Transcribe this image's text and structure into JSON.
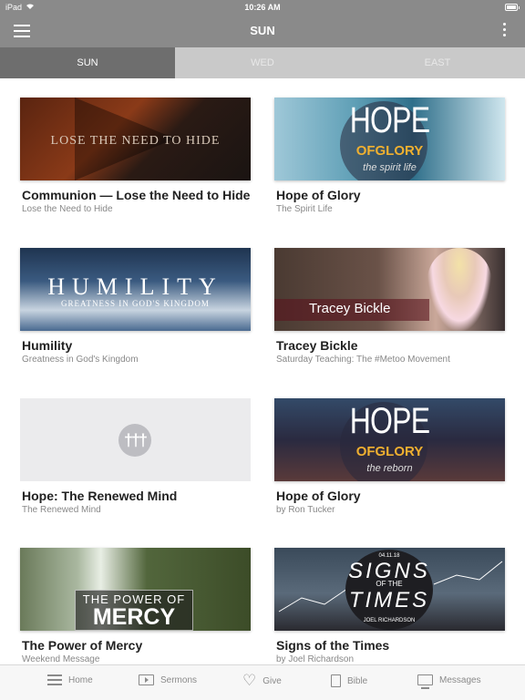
{
  "status_bar": {
    "device": "iPad",
    "time": "10:26 AM"
  },
  "nav": {
    "title": "SUN"
  },
  "tabs": [
    {
      "label": "SUN",
      "active": true
    },
    {
      "label": "WED",
      "active": false
    },
    {
      "label": "EAST",
      "active": false
    }
  ],
  "items": [
    {
      "title": "Communion — Lose the Need to Hide",
      "subtitle": "Lose the Need to Hide",
      "art": "LOSE THE NEED TO HIDE"
    },
    {
      "title": "Hope of Glory",
      "subtitle": "The Spirit Life",
      "art_big": "HOPE",
      "art_of": "OFGLORY",
      "art_sub": "the spirit life"
    },
    {
      "title": "Humility",
      "subtitle": "Greatness in God's Kingdom",
      "art_big": "HUMILITY",
      "art_small": "GREATNESS IN GOD'S KINGDOM"
    },
    {
      "title": "Tracey Bickle",
      "subtitle": "Saturday Teaching: The #Metoo Movement",
      "art": "Tracey Bickle"
    },
    {
      "title": "Hope: The Renewed Mind",
      "subtitle": "The Renewed Mind"
    },
    {
      "title": "Hope of Glory",
      "subtitle": "by Ron Tucker",
      "art_big": "HOPE",
      "art_of": "OFGLORY",
      "art_sub": "the reborn"
    },
    {
      "title": "The Power of Mercy",
      "subtitle": "Weekend Message",
      "art_line1": "THE POWER OF",
      "art_line2": "MERCY"
    },
    {
      "title": "Signs of the Times",
      "subtitle": "by Joel Richardson",
      "art_date": "04.11.18",
      "art_w1": "SIGNS",
      "art_w2": "OF THE",
      "art_w3": "TIMES",
      "art_w4": "JOEL RICHARDSON"
    }
  ],
  "tab_bar": {
    "home": "Home",
    "sermons": "Sermons",
    "give": "Give",
    "bible": "Bible",
    "messages": "Messages"
  },
  "colors": {
    "header": "#8a8a8a",
    "tab_active": "#6e6e6e",
    "tab_inactive": "#c9c9c9",
    "hope_accent": "#f0b030"
  }
}
